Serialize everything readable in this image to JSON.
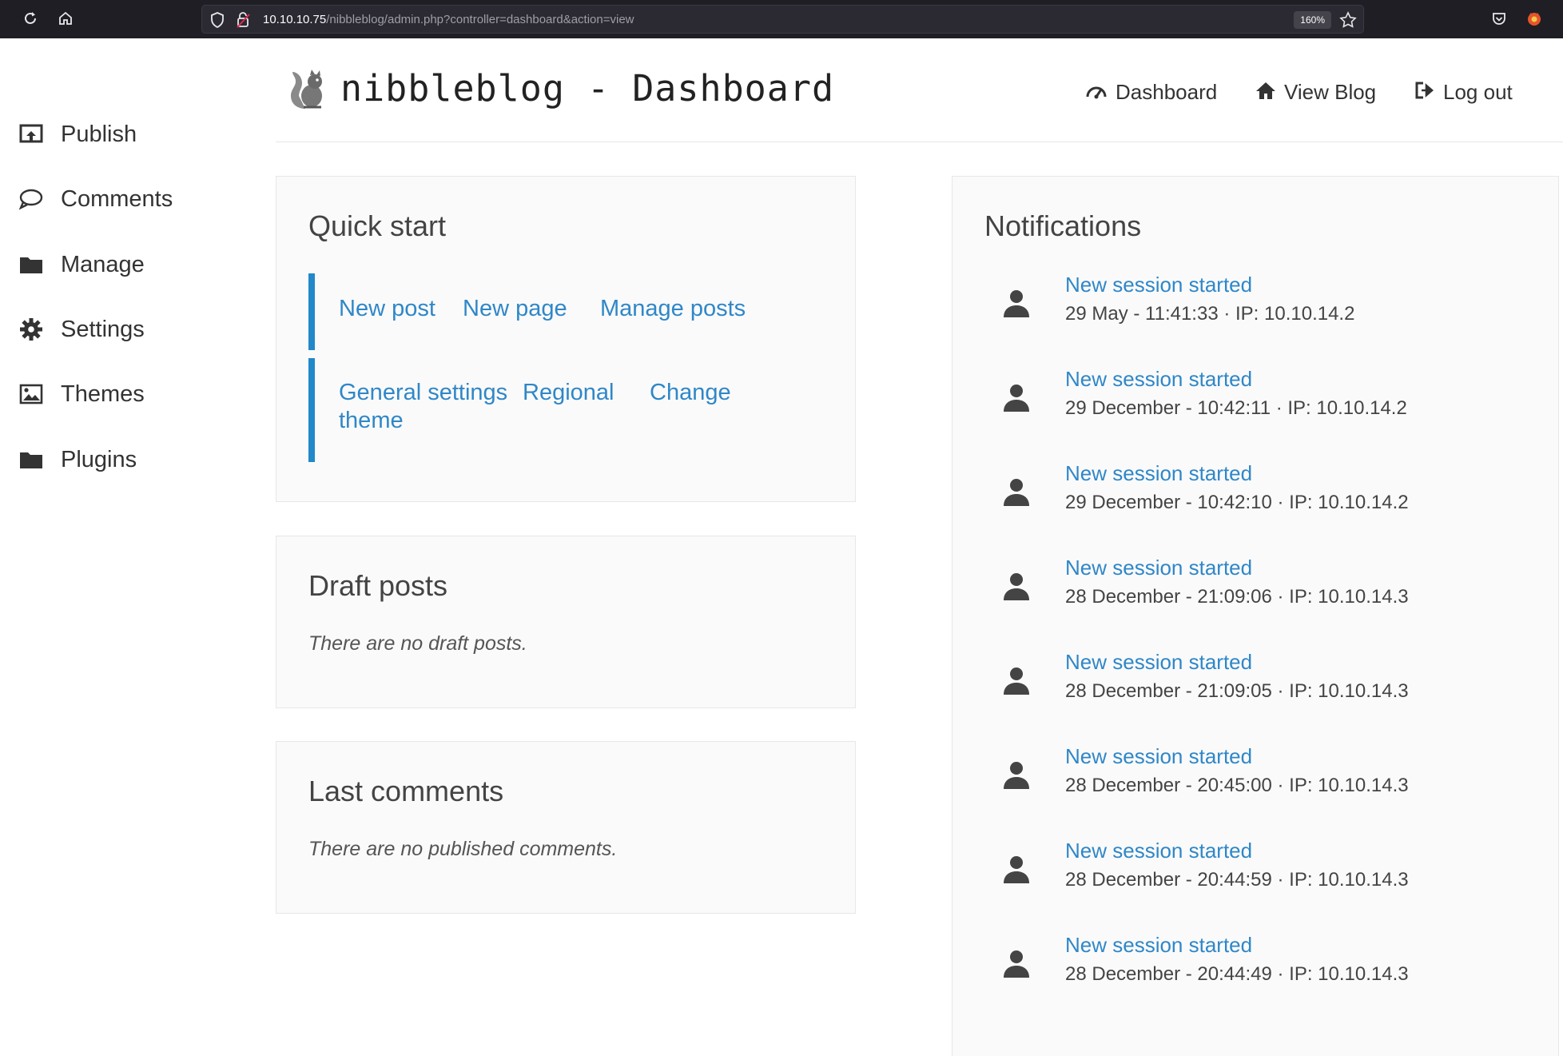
{
  "browser": {
    "url_host": "10.10.10.75",
    "url_path": "/nibbleblog/admin.php?controller=dashboard&action=view",
    "zoom": "160%"
  },
  "sidebar": {
    "items": [
      {
        "label": "Publish",
        "icon": "publish-icon"
      },
      {
        "label": "Comments",
        "icon": "comment-icon"
      },
      {
        "label": "Manage",
        "icon": "folder-icon"
      },
      {
        "label": "Settings",
        "icon": "gear-icon"
      },
      {
        "label": "Themes",
        "icon": "image-icon"
      },
      {
        "label": "Plugins",
        "icon": "folder-icon"
      }
    ]
  },
  "header": {
    "title": "nibbleblog - Dashboard",
    "nav": [
      {
        "label": "Dashboard",
        "icon": "dashboard-icon"
      },
      {
        "label": "View Blog",
        "icon": "home-icon"
      },
      {
        "label": "Log out",
        "icon": "logout-icon"
      }
    ]
  },
  "quick_start": {
    "title": "Quick start",
    "group1": [
      "New post",
      "New page",
      "Manage posts"
    ],
    "group2": [
      "General settings",
      "Regional",
      "Change",
      "theme"
    ]
  },
  "draft_posts": {
    "title": "Draft posts",
    "empty": "There are no draft posts."
  },
  "last_comments": {
    "title": "Last comments",
    "empty": "There are no published comments."
  },
  "notifications": {
    "title": "Notifications",
    "items": [
      {
        "title": "New session started",
        "detail": "29 May - 11:41:33 · IP: 10.10.14.2"
      },
      {
        "title": "New session started",
        "detail": "29 December - 10:42:11 · IP: 10.10.14.2"
      },
      {
        "title": "New session started",
        "detail": "29 December - 10:42:10 · IP: 10.10.14.2"
      },
      {
        "title": "New session started",
        "detail": "28 December - 21:09:06 · IP: 10.10.14.3"
      },
      {
        "title": "New session started",
        "detail": "28 December - 21:09:05 · IP: 10.10.14.3"
      },
      {
        "title": "New session started",
        "detail": "28 December - 20:45:00 · IP: 10.10.14.3"
      },
      {
        "title": "New session started",
        "detail": "28 December - 20:44:59 · IP: 10.10.14.3"
      },
      {
        "title": "New session started",
        "detail": "28 December - 20:44:49 · IP: 10.10.14.3"
      }
    ]
  },
  "colors": {
    "link": "#2f87c8",
    "accent_bar": "#2188c9",
    "browser_bg": "#1f1e25"
  }
}
